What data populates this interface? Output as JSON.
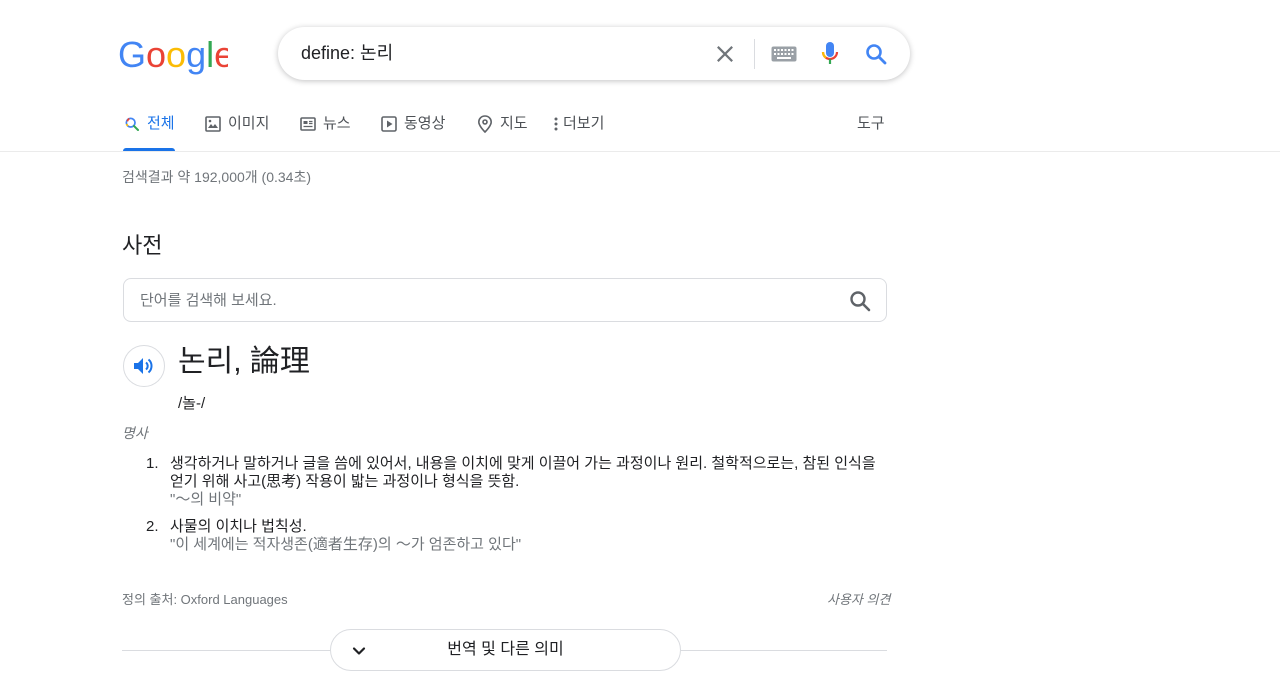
{
  "logo": {
    "text": "Google"
  },
  "search": {
    "query": "define: 논리",
    "icons": [
      "close-icon",
      "keyboard-icon",
      "mic-icon",
      "search-icon"
    ]
  },
  "tabs": [
    {
      "label": "전체",
      "icon": "search-icon",
      "active": true
    },
    {
      "label": "이미지",
      "icon": "image-icon"
    },
    {
      "label": "뉴스",
      "icon": "news-icon"
    },
    {
      "label": "동영상",
      "icon": "video-icon"
    },
    {
      "label": "지도",
      "icon": "map-pin-icon"
    },
    {
      "label": "더보기",
      "icon": "more-vert-icon"
    }
  ],
  "tools_label": "도구",
  "result_stats": "검색결과 약 192,000개 (0.34초)",
  "dictionary": {
    "title": "사전",
    "search_placeholder": "단어를 검색해 보세요.",
    "headword": "논리, 論理",
    "pronunciation": "/놀-/",
    "part_of_speech": "명사",
    "definitions": [
      {
        "num": "1.",
        "text": "생각하거나 말하거나 글을 씀에 있어서, 내용을 이치에 맞게 이끌어 가는 과정이나 원리. 철학적으로는, 참된 인식을 얻기 위해 사고(思考) 작용이 밟는 과정이나 형식을 뜻함.",
        "example": "\"～의 비약\""
      },
      {
        "num": "2.",
        "text": "사물의 이치나 법칙성.",
        "example": "\"이 세계에는 적자생존(適者生存)의 ～가 엄존하고 있다\""
      }
    ],
    "source": "정의 출처: Oxford Languages",
    "feedback": "사용자 의견",
    "expand_label": "번역 및 다른 의미"
  },
  "colors": {
    "accent": "#1a73e8",
    "text": "#202124",
    "muted": "#70757a",
    "border": "#dadce0"
  }
}
